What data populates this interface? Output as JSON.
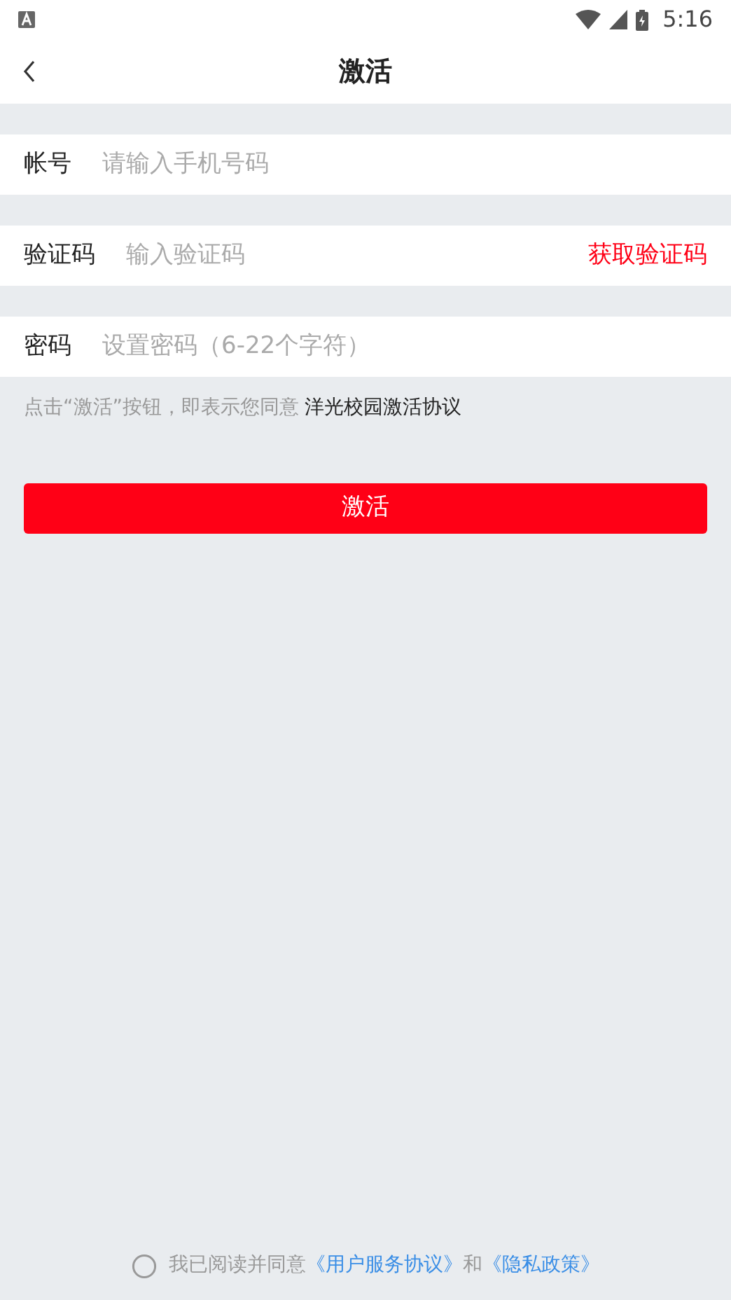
{
  "status_bar": {
    "time": "5:16"
  },
  "header": {
    "title": "激活"
  },
  "fields": [
    {
      "label": "帐号",
      "placeholder": "请输入手机号码"
    },
    {
      "label": "验证码",
      "placeholder": "输入验证码",
      "action": "获取验证码"
    },
    {
      "label": "密码",
      "placeholder": "设置密码（6-22个字符）"
    }
  ],
  "notice": {
    "text": "点击“激活”按钮，即表示您同意",
    "link": "洋光校园激活协议"
  },
  "submit_button": "激活",
  "agreement": {
    "checked": false,
    "text": "我已阅读并同意",
    "link_1": "《用户服务协议》",
    "joiner": "和",
    "link_2": "《隐私政策》"
  }
}
